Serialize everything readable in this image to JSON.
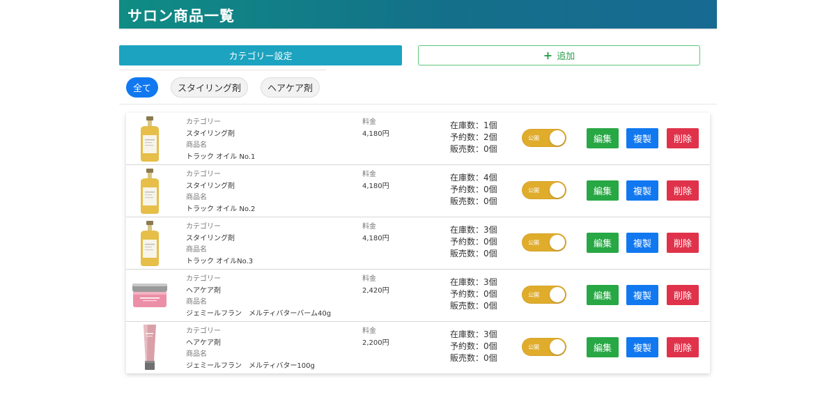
{
  "header": {
    "title": "サロン商品一覧"
  },
  "toolbar": {
    "category_label": "カテゴリー設定",
    "add_label": "追加"
  },
  "filters": [
    "全て",
    "スタイリング剤",
    "ヘアケア剤"
  ],
  "labels": {
    "category": "カテゴリー",
    "name": "商品名",
    "price": "料金",
    "publish": "公開"
  },
  "actions": {
    "edit": "編集",
    "duplicate": "複製",
    "delete": "削除"
  },
  "colors": {
    "accent": "#1ba3c0",
    "publish_toggle": "#e0ac2c",
    "edit": "#28a745",
    "duplicate": "#1178f0",
    "delete": "#e0334b"
  },
  "products": [
    {
      "category": "スタイリング剤",
      "name": "トラック オイル No.1",
      "price": "4,180円",
      "stock": "在庫数：1個",
      "reserved": "予約数：2個",
      "sold": "販売数：0個",
      "image": "oil-bottle-icon"
    },
    {
      "category": "スタイリング剤",
      "name": "トラック オイル No.2",
      "price": "4,180円",
      "stock": "在庫数：4個",
      "reserved": "予約数：0個",
      "sold": "販売数：0個",
      "image": "oil-bottle-icon"
    },
    {
      "category": "スタイリング剤",
      "name": "トラック オイルNo.3",
      "price": "4,180円",
      "stock": "在庫数：3個",
      "reserved": "予約数：0個",
      "sold": "販売数：0個",
      "image": "oil-bottle-icon"
    },
    {
      "category": "ヘアケア剤",
      "name": "ジェミールフラン　メルティバターバーム40g",
      "price": "2,420円",
      "stock": "在庫数：3個",
      "reserved": "予約数：0個",
      "sold": "販売数：0個",
      "image": "balm-jar-icon"
    },
    {
      "category": "ヘアケア剤",
      "name": "ジェミールフラン　メルティバター100g",
      "price": "2,200円",
      "stock": "在庫数：3個",
      "reserved": "予約数：0個",
      "sold": "販売数：0個",
      "image": "cream-tube-icon"
    }
  ]
}
